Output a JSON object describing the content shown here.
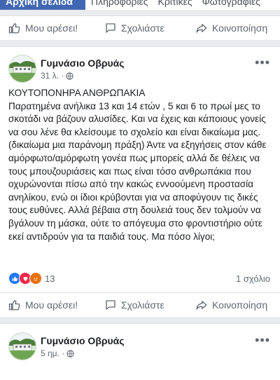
{
  "page_tabs": [
    "Αρχική σελίδα",
    "Πληροφορίες",
    "Κριτικές",
    "Φωτογραφίες"
  ],
  "actions": {
    "like": "Μου αρέσει!",
    "comment": "Σχολιάστε",
    "share": "Κοινοποίηση"
  },
  "post1": {
    "author": "Γυμνάσιο Οβρυάς",
    "time": "31 λ. ·",
    "paragraphs": [
      "ΚΟΥΤΟΠΟΝΗΡΑ ΑΝΘΡΩΠΑΚΙΑ",
      " Παρατημένα  ανήλικα 13 και 14 ετών , 5 και 6 το πρωί μες το σκοτάδι να βάζουν αλυσίδες. Και να έχεις και κάποιους γονείς να σου λένε θα κλείσουμε το σχολείο και είναι δικαίωμα μας.(δικαίωμα μια παράνομη πράξη) Άντε να εξηγήσεις στον κάθε αμόρφωτο/αμόρφωτη γονέα πως μπορείς αλλά δε θέλεις να τους μπουζουριάσεις  και πως είναι τόσο ανθρωπάκια  που οχυρώνονται πίσω από την κακώς εννοούμενη προστασία ανηλίκου, ενώ οι ίδιοι κρύβονται  για να αποφύγουν τις δικές τους ευθύνες. Αλλά βέβαια στη δουλειά τους δεν τολμούν να βγάλουν τη μάσκα, ούτε το απόγευμα στο φροντιστήριο ούτε  εκεί αντιδρούν για τα παιδιά τους. Μα πόσο λίγοι;"
    ],
    "reactions_count": "13",
    "comments_count": "1 σχόλιο"
  },
  "post2": {
    "author": "Γυμνάσιο Οβρυάς",
    "time": "5 ημ. ·"
  }
}
